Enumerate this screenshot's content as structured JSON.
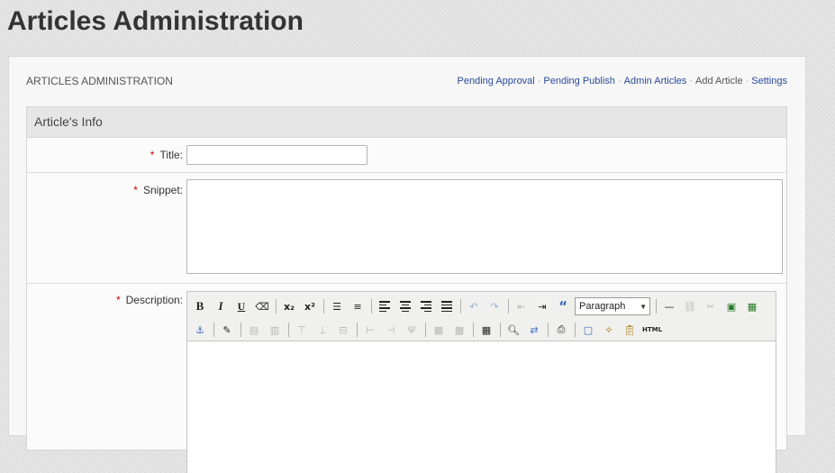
{
  "page": {
    "title": "Articles Administration"
  },
  "panel": {
    "heading": "ARTICLES ADMINISTRATION",
    "nav": [
      {
        "label": "Pending Approval",
        "link": true
      },
      {
        "label": "Pending Publish",
        "link": true
      },
      {
        "label": "Admin Articles",
        "link": true
      },
      {
        "label": "Add Article",
        "link": false
      },
      {
        "label": "Settings",
        "link": true
      }
    ],
    "separator": "·"
  },
  "form": {
    "section_title": "Article's Info",
    "required_mark": "*",
    "title_label": "Title:",
    "title_value": "",
    "snippet_label": "Snippet:",
    "snippet_value": "",
    "description_label": "Description:"
  },
  "editor": {
    "format_select": "Paragraph",
    "toolbar_row1": [
      "bold",
      "italic",
      "underline",
      "remove-format",
      "subscript",
      "superscript",
      "bullet-list",
      "numbered-list",
      "align-left",
      "align-center",
      "align-right",
      "align-justify",
      "undo",
      "redo",
      "outdent",
      "indent",
      "blockquote",
      "format-select",
      "horizontal-rule",
      "link",
      "unlink",
      "image",
      "media"
    ],
    "toolbar_row2": [
      "anchor",
      "edit",
      "table-row-props",
      "table-cell-props",
      "insert-row-before",
      "insert-row-after",
      "delete-row",
      "insert-col-before",
      "insert-col-after",
      "delete-col",
      "split-cells",
      "merge-cells",
      "insert-table",
      "find",
      "replace",
      "print",
      "fullscreen",
      "cleanup",
      "paste-word",
      "html-source"
    ],
    "html_label": "HTML"
  },
  "colors": {
    "link": "#2a4a9a",
    "required": "#cc0000"
  }
}
